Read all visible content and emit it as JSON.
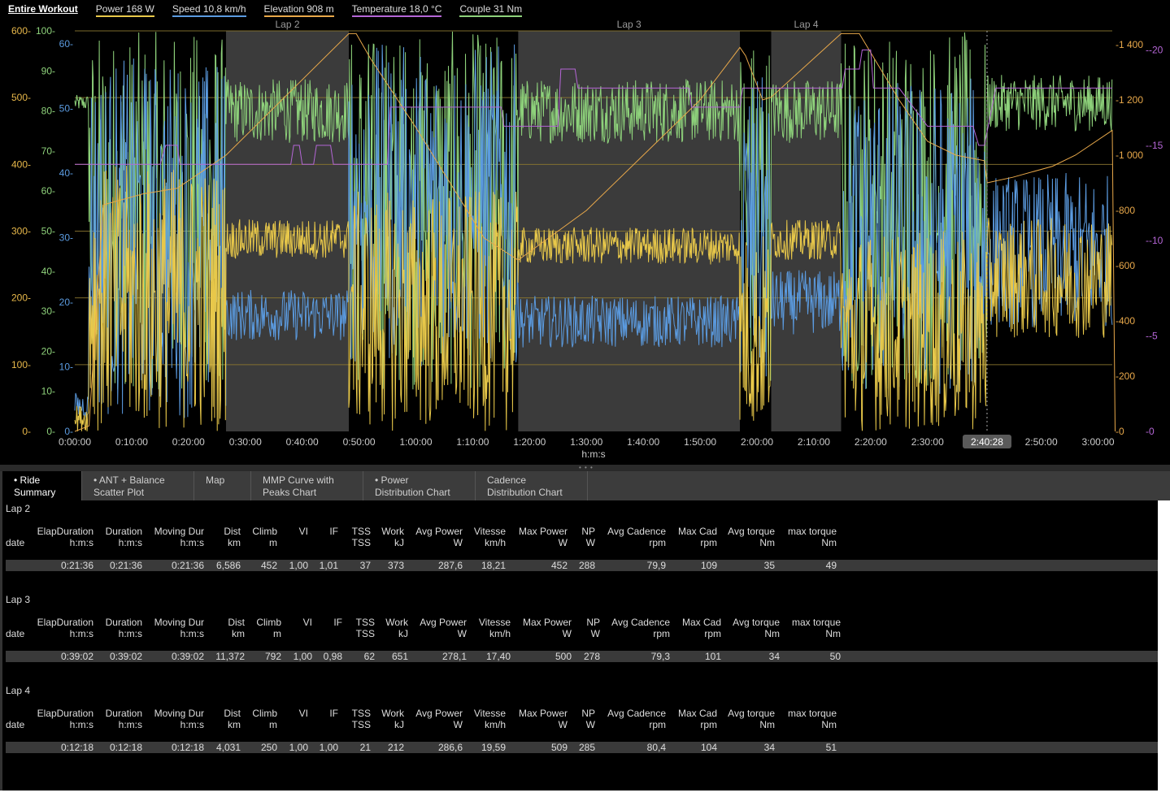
{
  "legend": {
    "title": "Entire Workout",
    "items": [
      {
        "label": "Power  168 W",
        "cls": "power"
      },
      {
        "label": "Speed  10,8 km/h",
        "cls": "speed"
      },
      {
        "label": "Elevation  908 m",
        "cls": "elev"
      },
      {
        "label": "Temperature  18,0 °C",
        "cls": "temp"
      },
      {
        "label": "Couple  31 Nm",
        "cls": "torque"
      }
    ]
  },
  "chart_data": {
    "type": "line",
    "xlabel": "h:m:s",
    "x_ticks": [
      "0:00:00",
      "0:10:00",
      "0:20:00",
      "0:30:00",
      "0:40:00",
      "0:50:00",
      "1:00:00",
      "1:10:00",
      "1:20:00",
      "1:30:00",
      "1:40:00",
      "1:50:00",
      "2:00:00",
      "2:10:00",
      "2:20:00",
      "2:30:00",
      "2:40:28",
      "2:50:00",
      "3:00:00"
    ],
    "cursor_label": "2:40:28",
    "xlim_minutes": [
      0,
      182.5
    ],
    "axes": {
      "power": {
        "ticks": [
          "0",
          "100",
          "200",
          "300",
          "400",
          "500",
          "600"
        ],
        "ylim": [
          0,
          600
        ],
        "color": "#e8b84a"
      },
      "torque": {
        "ticks": [
          "0",
          "10",
          "20",
          "30",
          "40",
          "50",
          "60",
          "70",
          "80",
          "90",
          "100"
        ],
        "ylim": [
          0,
          100
        ],
        "color": "#8ed27b"
      },
      "speed": {
        "ticks": [
          "0",
          "10",
          "20",
          "30",
          "40",
          "50",
          "60"
        ],
        "ylim": [
          0,
          62
        ],
        "color": "#5b9be0"
      },
      "elevation": {
        "ticks": [
          "0",
          "200",
          "400",
          "600",
          "800",
          "1 000",
          "1 200",
          "1 400"
        ],
        "ylim": [
          0,
          1450
        ],
        "color": "#e8a84a"
      },
      "temperature": {
        "ticks": [
          "0",
          "-5",
          "-10",
          "-15",
          "-20"
        ],
        "ylim": [
          0,
          -21
        ],
        "color": "#b566d6"
      }
    },
    "laps": [
      {
        "label": "Lap 2",
        "start_min": 26.6,
        "end_min": 48.2
      },
      {
        "label": "Lap 3",
        "start_min": 78.0,
        "end_min": 117.0
      },
      {
        "label": "Lap 4",
        "start_min": 122.5,
        "end_min": 134.8
      }
    ],
    "series": [
      {
        "name": "Power",
        "color": "#e8c84a",
        "segments": [
          {
            "start": 0,
            "end": 2.5,
            "mean": 20,
            "amp": 20
          },
          {
            "start": 2.5,
            "end": 26.6,
            "mean": 200,
            "amp": 200
          },
          {
            "start": 26.6,
            "end": 48.2,
            "mean": 288,
            "amp": 30
          },
          {
            "start": 48.2,
            "end": 78.0,
            "mean": 180,
            "amp": 180
          },
          {
            "start": 78.0,
            "end": 117.0,
            "mean": 278,
            "amp": 28
          },
          {
            "start": 117.0,
            "end": 122.5,
            "mean": 150,
            "amp": 150
          },
          {
            "start": 122.5,
            "end": 134.8,
            "mean": 287,
            "amp": 30
          },
          {
            "start": 134.8,
            "end": 160.5,
            "mean": 150,
            "amp": 150
          },
          {
            "start": 160.5,
            "end": 182.5,
            "mean": 230,
            "amp": 90
          }
        ]
      },
      {
        "name": "Speed",
        "color": "#5b9be0",
        "segments": [
          {
            "start": 0,
            "end": 2.5,
            "mean": 4,
            "amp": 2
          },
          {
            "start": 2.5,
            "end": 26.6,
            "mean": 30,
            "amp": 28
          },
          {
            "start": 26.6,
            "end": 48.2,
            "mean": 18,
            "amp": 4
          },
          {
            "start": 48.2,
            "end": 78.0,
            "mean": 35,
            "amp": 25
          },
          {
            "start": 78.0,
            "end": 117.0,
            "mean": 17,
            "amp": 4
          },
          {
            "start": 117.0,
            "end": 122.5,
            "mean": 30,
            "amp": 25
          },
          {
            "start": 122.5,
            "end": 134.8,
            "mean": 20,
            "amp": 5
          },
          {
            "start": 134.8,
            "end": 160.5,
            "mean": 30,
            "amp": 25
          },
          {
            "start": 160.5,
            "end": 182.5,
            "mean": 28,
            "amp": 12
          }
        ]
      },
      {
        "name": "Couple",
        "color": "#8ed27b",
        "segments": [
          {
            "start": 0,
            "end": 2.5,
            "mean": 82,
            "amp": 2
          },
          {
            "start": 2.5,
            "end": 26.6,
            "mean": 55,
            "amp": 45
          },
          {
            "start": 26.6,
            "end": 48.2,
            "mean": 80,
            "amp": 8
          },
          {
            "start": 48.2,
            "end": 78.0,
            "mean": 55,
            "amp": 45
          },
          {
            "start": 78.0,
            "end": 117.0,
            "mean": 80,
            "amp": 8
          },
          {
            "start": 117.0,
            "end": 122.5,
            "mean": 55,
            "amp": 45
          },
          {
            "start": 122.5,
            "end": 134.8,
            "mean": 80,
            "amp": 8
          },
          {
            "start": 134.8,
            "end": 160.5,
            "mean": 55,
            "amp": 45
          },
          {
            "start": 160.5,
            "end": 182.5,
            "mean": 82,
            "amp": 7
          }
        ]
      },
      {
        "name": "Elevation",
        "color": "#e8a84a",
        "points": [
          [
            0,
            0
          ],
          [
            2.5,
            20
          ],
          [
            5,
            820
          ],
          [
            12,
            860
          ],
          [
            18,
            880
          ],
          [
            26.6,
            1000
          ],
          [
            48.2,
            1440
          ],
          [
            49.5,
            1440
          ],
          [
            52,
            1350
          ],
          [
            60,
            1100
          ],
          [
            66,
            900
          ],
          [
            72,
            700
          ],
          [
            78,
            620
          ],
          [
            80,
            650
          ],
          [
            90,
            800
          ],
          [
            100,
            1000
          ],
          [
            110,
            1200
          ],
          [
            117,
            1390
          ],
          [
            118,
            1360
          ],
          [
            121,
            1200
          ],
          [
            122.5,
            1210
          ],
          [
            134.8,
            1440
          ],
          [
            138,
            1440
          ],
          [
            145,
            1200
          ],
          [
            150,
            1050
          ],
          [
            155,
            1000
          ],
          [
            160,
            980
          ],
          [
            160.5,
            900
          ],
          [
            165,
            920
          ],
          [
            172,
            960
          ],
          [
            176,
            1000
          ],
          [
            182.5,
            1090
          ],
          [
            183,
            0
          ]
        ]
      },
      {
        "name": "Temperature",
        "color": "#b566d6",
        "points": [
          [
            0,
            -14
          ],
          [
            15,
            -14
          ],
          [
            16,
            -15
          ],
          [
            18,
            -15
          ],
          [
            18.5,
            -14
          ],
          [
            38,
            -14
          ],
          [
            38.5,
            -15
          ],
          [
            39.5,
            -15
          ],
          [
            40,
            -14
          ],
          [
            42,
            -14
          ],
          [
            42.5,
            -15
          ],
          [
            45,
            -15
          ],
          [
            45.5,
            -14
          ],
          [
            55,
            -14
          ],
          [
            55.5,
            -17
          ],
          [
            75,
            -17
          ],
          [
            75.5,
            -16
          ],
          [
            85,
            -16
          ],
          [
            85.5,
            -19
          ],
          [
            88,
            -19
          ],
          [
            88.5,
            -18
          ],
          [
            108,
            -18
          ],
          [
            108.5,
            -17
          ],
          [
            117,
            -17
          ],
          [
            117.5,
            -18
          ],
          [
            135,
            -18
          ],
          [
            135.5,
            -19
          ],
          [
            138,
            -19
          ],
          [
            138.5,
            -20
          ],
          [
            140,
            -20
          ],
          [
            140.5,
            -18
          ],
          [
            145,
            -18
          ],
          [
            150,
            -16
          ],
          [
            158,
            -16
          ],
          [
            159,
            -15
          ],
          [
            160,
            -15
          ],
          [
            162,
            -18
          ],
          [
            182.5,
            -18
          ]
        ]
      }
    ]
  },
  "tabs": [
    {
      "label": "• Ride\nSummary",
      "active": true
    },
    {
      "label": "• ANT + Balance\nScatter Plot",
      "active": false
    },
    {
      "label": "Map",
      "active": false
    },
    {
      "label": "MMP Curve with\nPeaks Chart",
      "active": false
    },
    {
      "label": "• Power\nDistribution Chart",
      "active": false
    },
    {
      "label": "Cadence\nDistribution Chart",
      "active": false
    }
  ],
  "summary": {
    "laps": [
      {
        "title": "Lap 2",
        "headers": [
          [
            "date",
            ""
          ],
          [
            "ElapDuration",
            "h:m:s"
          ],
          [
            "Duration",
            "h:m:s"
          ],
          [
            "Moving Dur",
            "h:m:s"
          ],
          [
            "Dist",
            "km"
          ],
          [
            "Climb",
            "m"
          ],
          [
            "VI",
            ""
          ],
          [
            "IF",
            ""
          ],
          [
            "TSS",
            "TSS"
          ],
          [
            "Work",
            "kJ"
          ],
          [
            "Avg Power",
            "W"
          ],
          [
            "Vitesse",
            "km/h"
          ],
          [
            "Max Power",
            "W"
          ],
          [
            "NP",
            "W"
          ],
          [
            "Avg Cadence",
            "rpm"
          ],
          [
            "Max Cad",
            "rpm"
          ],
          [
            "Avg torque",
            "Nm"
          ],
          [
            "max torque",
            "Nm"
          ]
        ],
        "values": [
          "",
          "0:21:36",
          "0:21:36",
          "0:21:36",
          "6,586",
          "452",
          "1,00",
          "1,01",
          "37",
          "373",
          "287,6",
          "18,21",
          "452",
          "288",
          "79,9",
          "109",
          "35",
          "49"
        ]
      },
      {
        "title": "Lap 3",
        "headers": [
          [
            "date",
            ""
          ],
          [
            "ElapDuration",
            "h:m:s"
          ],
          [
            "Duration",
            "h:m:s"
          ],
          [
            "Moving Dur",
            "h:m:s"
          ],
          [
            "Dist",
            "km"
          ],
          [
            "Climb",
            "m"
          ],
          [
            "VI",
            ""
          ],
          [
            "IF",
            ""
          ],
          [
            "TSS",
            "TSS"
          ],
          [
            "Work",
            "kJ"
          ],
          [
            "Avg Power",
            "W"
          ],
          [
            "Vitesse",
            "km/h"
          ],
          [
            "Max Power",
            "W"
          ],
          [
            "NP",
            "W"
          ],
          [
            "Avg Cadence",
            "rpm"
          ],
          [
            "Max Cad",
            "rpm"
          ],
          [
            "Avg torque",
            "Nm"
          ],
          [
            "max torque",
            "Nm"
          ]
        ],
        "values": [
          "",
          "0:39:02",
          "0:39:02",
          "0:39:02",
          "11,372",
          "792",
          "1,00",
          "0,98",
          "62",
          "651",
          "278,1",
          "17,40",
          "500",
          "278",
          "79,3",
          "101",
          "34",
          "50"
        ]
      },
      {
        "title": "Lap 4",
        "headers": [
          [
            "date",
            ""
          ],
          [
            "ElapDuration",
            "h:m:s"
          ],
          [
            "Duration",
            "h:m:s"
          ],
          [
            "Moving Dur",
            "h:m:s"
          ],
          [
            "Dist",
            "km"
          ],
          [
            "Climb",
            "m"
          ],
          [
            "VI",
            ""
          ],
          [
            "IF",
            ""
          ],
          [
            "TSS",
            "TSS"
          ],
          [
            "Work",
            "kJ"
          ],
          [
            "Avg Power",
            "W"
          ],
          [
            "Vitesse",
            "km/h"
          ],
          [
            "Max Power",
            "W"
          ],
          [
            "NP",
            "W"
          ],
          [
            "Avg Cadence",
            "rpm"
          ],
          [
            "Max Cad",
            "rpm"
          ],
          [
            "Avg torque",
            "Nm"
          ],
          [
            "max torque",
            "Nm"
          ]
        ],
        "values": [
          "",
          "0:12:18",
          "0:12:18",
          "0:12:18",
          "4,031",
          "250",
          "1,00",
          "1,00",
          "21",
          "212",
          "286,6",
          "19,59",
          "509",
          "285",
          "80,4",
          "104",
          "34",
          "51"
        ]
      }
    ]
  }
}
